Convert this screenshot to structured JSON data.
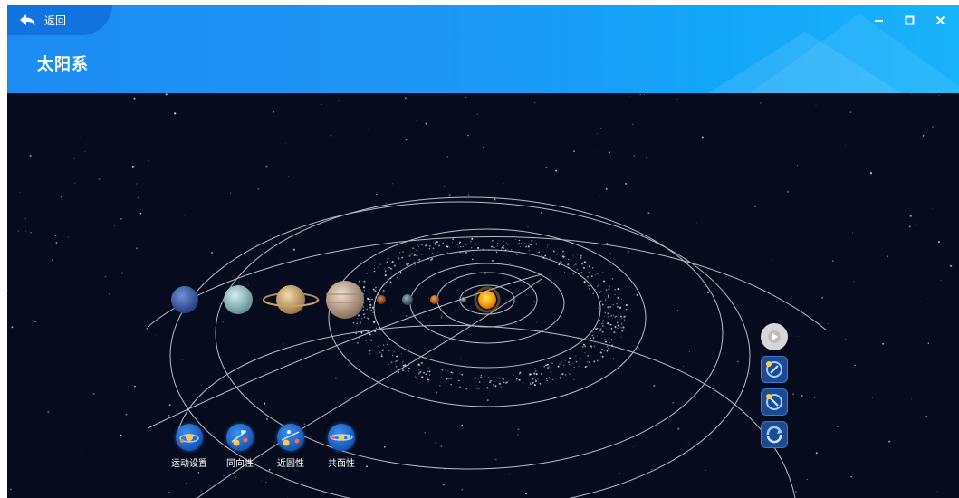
{
  "header": {
    "back_label": "返回",
    "title": "太阳系"
  },
  "colors": {
    "header_start": "#1c8cf2",
    "header_end": "#19b3fb",
    "back_tab": "#1174de",
    "space": "#060b1d",
    "orbit": "#d9dde6",
    "sun": "#f6a21a"
  },
  "toolbar": {
    "items": [
      {
        "id": "motion-settings",
        "label": "运动设置",
        "icon": "solar-system-settings-icon"
      },
      {
        "id": "same-direction",
        "label": "同向性",
        "icon": "orbit-same-direction-icon"
      },
      {
        "id": "near-circular",
        "label": "近圆性",
        "icon": "orbit-near-circular-icon"
      },
      {
        "id": "coplanar",
        "label": "共面性",
        "icon": "orbit-coplanar-icon"
      }
    ]
  },
  "side_controls": [
    "play-icon",
    "zoom-in-orbit-icon",
    "zoom-out-orbit-icon",
    "rotate-view-icon"
  ],
  "planets": [
    {
      "name": "neptune",
      "color": "#3c5ea8"
    },
    {
      "name": "uranus",
      "color": "#9fc7c9"
    },
    {
      "name": "saturn",
      "color": "#d9b77c"
    },
    {
      "name": "jupiter",
      "color": "#c9a98b"
    },
    {
      "name": "mars",
      "color": "#b2552c"
    },
    {
      "name": "earth",
      "color": "#3e6c7c"
    },
    {
      "name": "venus",
      "color": "#c86a25"
    },
    {
      "name": "mercury",
      "color": "#8a7d6a"
    }
  ]
}
